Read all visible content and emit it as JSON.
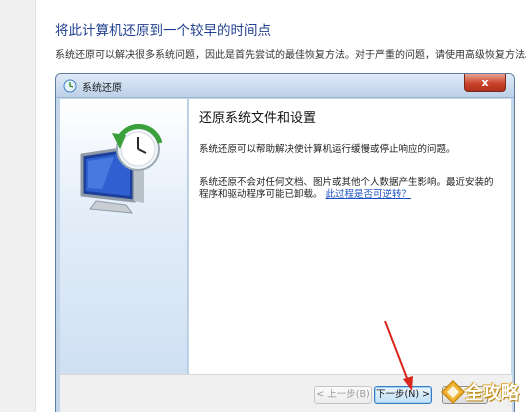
{
  "doc": {
    "heading": "将此计算机还原到一个较早的时间点",
    "paragraph": "系统还原可以解决很多系统问题，因此是首先尝试的最佳恢复方法。对于严重的问题，请使用高级恢复方法。"
  },
  "dialog": {
    "title": "系统还原",
    "close_label": "x",
    "content_title": "还原系统文件和设置",
    "para1": "系统还原可以帮助解决使计算机运行缓慢或停止响应的问题。",
    "para2": "系统还原不会对任何文档、图片或其他个人数据产生影响。最近安装的程序和驱动程序可能已卸载。",
    "para2_link": "此过程是否可逆转？",
    "status_text": "",
    "buttons": {
      "back": "< 上一步(B)",
      "next": "下一步(N) >",
      "cancel": ""
    }
  },
  "watermark": {
    "text": "全攻略"
  },
  "colors": {
    "heading_blue": "#1f3f8f",
    "link_blue": "#1a4fc4",
    "arrow_red": "#d9261c",
    "close_red": "#c9432a"
  },
  "icons": {
    "title_icon": "system-restore-icon",
    "hero_icon": "restore-monitor-icon",
    "watermark_icon": "watermark-logo-icon"
  }
}
